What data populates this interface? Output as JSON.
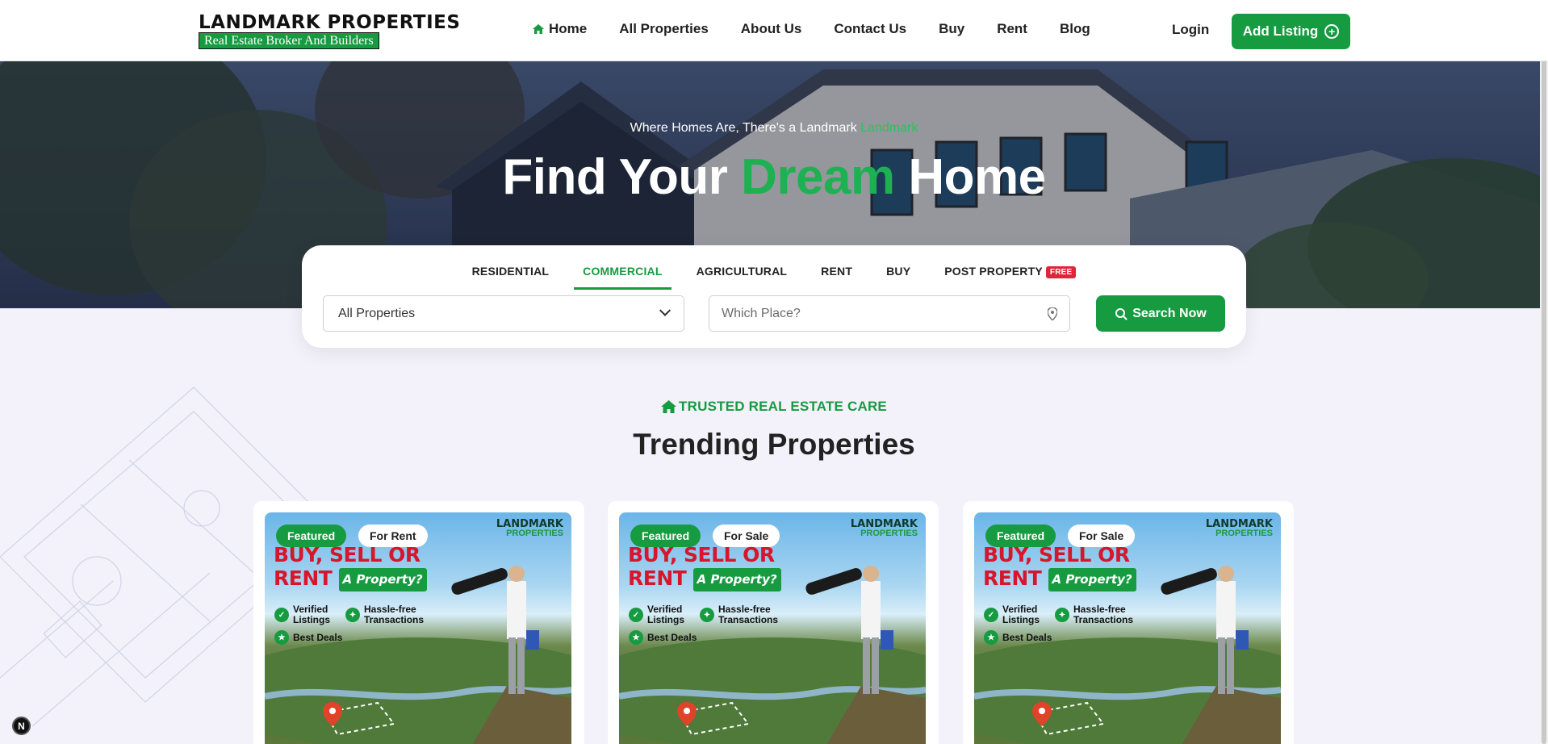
{
  "brand": {
    "name": "LANDMARK PROPERTIES",
    "tagline": "Real Estate Broker And Builders"
  },
  "nav": {
    "items": [
      {
        "label": "Home",
        "icon": "home-icon",
        "active": true
      },
      {
        "label": "All Properties"
      },
      {
        "label": "About Us"
      },
      {
        "label": "Contact Us"
      },
      {
        "label": "Buy"
      },
      {
        "label": "Rent"
      },
      {
        "label": "Blog"
      }
    ],
    "login": "Login",
    "add_listing": "Add Listing"
  },
  "hero": {
    "tagline_prefix": "Where Homes Are, There's a Landmark",
    "tagline_accent": "Landmark",
    "title_part1": "Find Your",
    "title_accent": "Dream",
    "title_part2": "Home"
  },
  "search": {
    "tabs": [
      {
        "label": "RESIDENTIAL"
      },
      {
        "label": "COMMERCIAL",
        "active": true
      },
      {
        "label": "AGRICULTURAL"
      },
      {
        "label": "RENT"
      },
      {
        "label": "BUY"
      },
      {
        "label": "POST PROPERTY",
        "badge": "FREE"
      }
    ],
    "property_select": "All Properties",
    "place_placeholder": "Which Place?",
    "button": "Search Now"
  },
  "section": {
    "eyebrow": "TRUSTED REAL ESTATE CARE",
    "title": "Trending Properties"
  },
  "cards": [
    {
      "badge_featured": "Featured",
      "badge_type": "For Rent"
    },
    {
      "badge_featured": "Featured",
      "badge_type": "For Sale"
    },
    {
      "badge_featured": "Featured",
      "badge_type": "For Sale"
    }
  ],
  "promo": {
    "logo_line1": "LANDMARK",
    "logo_line2": "PROPERTIES",
    "headline_line1": "BUY, SELL OR",
    "headline_line2": "RENT",
    "headline_sub": "A Property?",
    "feature1": "Verified Listings",
    "feature2": "Hassle-free Transactions",
    "feature3": "Best Deals"
  },
  "dev_badge": "N",
  "colors": {
    "brand_green": "#169b41",
    "accent_red": "#e0243a",
    "page_bg": "#f3f1fa"
  }
}
